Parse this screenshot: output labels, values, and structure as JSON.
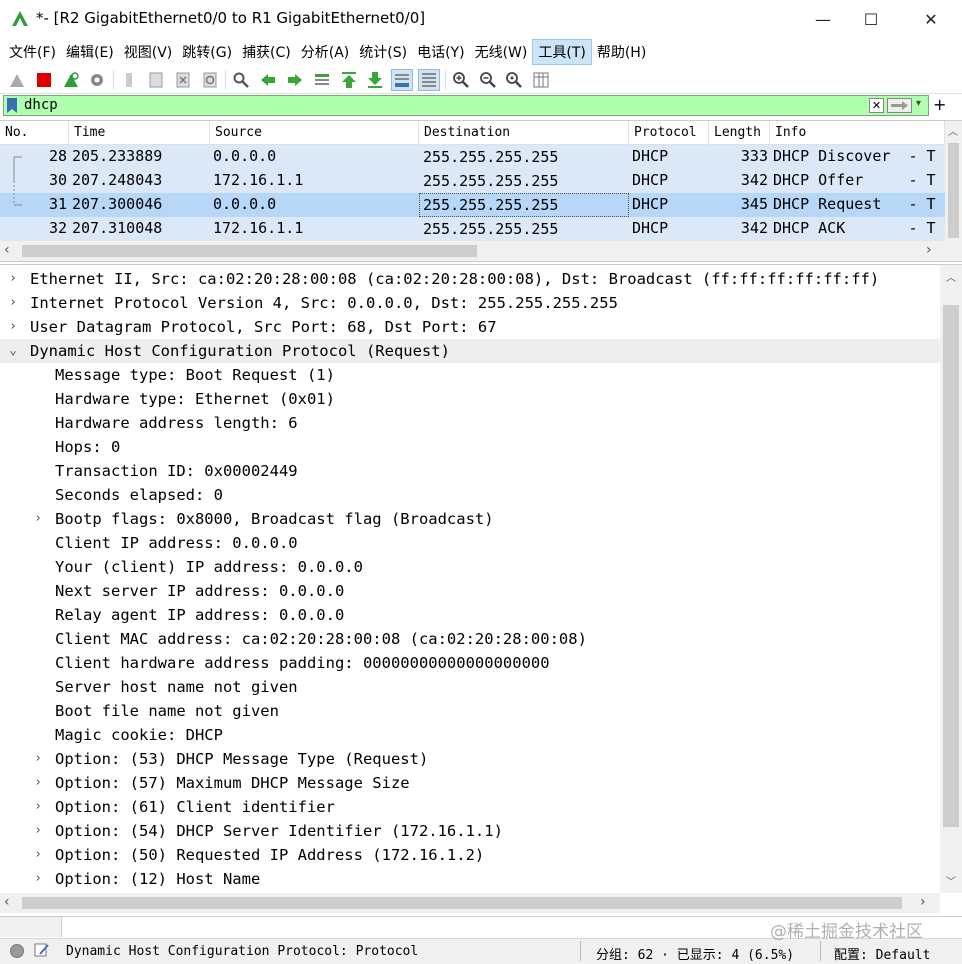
{
  "window": {
    "title": "*- [R2 GigabitEthernet0/0 to R1 GigabitEthernet0/0]",
    "minimize": "—",
    "maximize": "☐",
    "close": "✕"
  },
  "menu": [
    {
      "label": "文件(F)"
    },
    {
      "label": "编辑(E)"
    },
    {
      "label": "视图(V)"
    },
    {
      "label": "跳转(G)"
    },
    {
      "label": "捕获(C)"
    },
    {
      "label": "分析(A)"
    },
    {
      "label": "统计(S)"
    },
    {
      "label": "电话(Y)"
    },
    {
      "label": "无线(W)"
    },
    {
      "label": "工具(T)"
    },
    {
      "label": "帮助(H)"
    }
  ],
  "filter": {
    "value": "dhcp",
    "add_label": "+"
  },
  "packet_list": {
    "columns": [
      "No.",
      "Time",
      "Source",
      "Destination",
      "Protocol",
      "Length",
      "Info"
    ],
    "rows": [
      {
        "no": "28",
        "time": "205.233889",
        "src": "0.0.0.0",
        "dst": "255.255.255.255",
        "proto": "DHCP",
        "len": "333",
        "info": "DHCP Discover  - T"
      },
      {
        "no": "30",
        "time": "207.248043",
        "src": "172.16.1.1",
        "dst": "255.255.255.255",
        "proto": "DHCP",
        "len": "342",
        "info": "DHCP Offer     - T"
      },
      {
        "no": "31",
        "time": "207.300046",
        "src": "0.0.0.0",
        "dst": "255.255.255.255",
        "proto": "DHCP",
        "len": "345",
        "info": "DHCP Request   - T"
      },
      {
        "no": "32",
        "time": "207.310048",
        "src": "172.16.1.1",
        "dst": "255.255.255.255",
        "proto": "DHCP",
        "len": "342",
        "info": "DHCP ACK       - T"
      }
    ]
  },
  "details": [
    {
      "text": "Ethernet II, Src: ca:02:20:28:00:08 (ca:02:20:28:00:08), Dst: Broadcast (ff:ff:ff:ff:ff:ff)",
      "arrow": "›"
    },
    {
      "text": "Internet Protocol Version 4, Src: 0.0.0.0, Dst: 255.255.255.255",
      "arrow": "›"
    },
    {
      "text": "User Datagram Protocol, Src Port: 68, Dst Port: 67",
      "arrow": "›"
    },
    {
      "text": "Dynamic Host Configuration Protocol (Request)",
      "arrow": "⌄"
    },
    {
      "text": "Message type: Boot Request (1)",
      "arrow": ""
    },
    {
      "text": "Hardware type: Ethernet (0x01)",
      "arrow": ""
    },
    {
      "text": "Hardware address length: 6",
      "arrow": ""
    },
    {
      "text": "Hops: 0",
      "arrow": ""
    },
    {
      "text": "Transaction ID: 0x00002449",
      "arrow": ""
    },
    {
      "text": "Seconds elapsed: 0",
      "arrow": ""
    },
    {
      "text": "Bootp flags: 0x8000, Broadcast flag (Broadcast)",
      "arrow": "›"
    },
    {
      "text": "Client IP address: 0.0.0.0",
      "arrow": ""
    },
    {
      "text": "Your (client) IP address: 0.0.0.0",
      "arrow": ""
    },
    {
      "text": "Next server IP address: 0.0.0.0",
      "arrow": ""
    },
    {
      "text": "Relay agent IP address: 0.0.0.0",
      "arrow": ""
    },
    {
      "text": "Client MAC address: ca:02:20:28:00:08 (ca:02:20:28:00:08)",
      "arrow": ""
    },
    {
      "text": "Client hardware address padding: 00000000000000000000",
      "arrow": ""
    },
    {
      "text": "Server host name not given",
      "arrow": ""
    },
    {
      "text": "Boot file name not given",
      "arrow": ""
    },
    {
      "text": "Magic cookie: DHCP",
      "arrow": ""
    },
    {
      "text": "Option: (53) DHCP Message Type (Request)",
      "arrow": "›"
    },
    {
      "text": "Option: (57) Maximum DHCP Message Size",
      "arrow": "›"
    },
    {
      "text": "Option: (61) Client identifier",
      "arrow": "›"
    },
    {
      "text": "Option: (54) DHCP Server Identifier (172.16.1.1)",
      "arrow": "›"
    },
    {
      "text": "Option: (50) Requested IP Address (172.16.1.2)",
      "arrow": "›"
    },
    {
      "text": "Option: (12) Host Name",
      "arrow": "›"
    }
  ],
  "status": {
    "field_info": "Dynamic Host Configuration Protocol: Protocol",
    "packets": "分组: 62 · 已显示: 4 (6.5%)",
    "profile": "配置: Default"
  },
  "watermark": "@稀土掘金技术社区",
  "colors": {
    "filter_bg": "#afffaf",
    "row_bg": "#dae8f7",
    "row_selected": "#b6d7f7",
    "logo_green": "#2e9e3a"
  }
}
